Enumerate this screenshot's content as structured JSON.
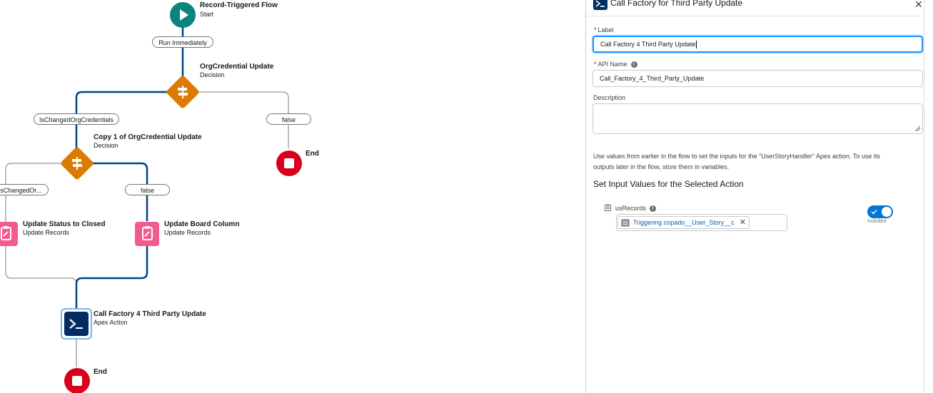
{
  "flow": {
    "start": {
      "title": "Record-Triggered Flow",
      "subtitle": "Start"
    },
    "run_pill": "Run Immediately",
    "decision1": {
      "title": "OrgCredential Update",
      "subtitle": "Decision"
    },
    "outcome_true1": "IsChangedOrgCredentials",
    "outcome_false1": "false",
    "end1": "End",
    "decision2": {
      "title": "Copy 1 of OrgCredential Update",
      "subtitle": "Decision"
    },
    "outcome_true2": "IsChangedOr...",
    "outcome_false2": "false",
    "update1": {
      "title": "Update Status to Closed",
      "subtitle": "Update Records"
    },
    "update2": {
      "title": "Update Board Column",
      "subtitle": "Update Records"
    },
    "apex": {
      "title": "Call Factory 4 Third Party Update",
      "subtitle": "Apex Action"
    },
    "end2": "End"
  },
  "panel": {
    "title": "Call Factory for Third Party Update",
    "close": "✕",
    "label_field": {
      "label": "Label",
      "value": "Call Factory 4 Third Party Update"
    },
    "api_field": {
      "label": "API Name",
      "value": "Call_Factory_4_Third_Party_Update"
    },
    "description_field": {
      "label": "Description",
      "value": ""
    },
    "help_line1": "Use values from earlier in the flow to set the inputs for the \"UserStoryHandler\" Apex action. To use its",
    "help_line2": "outputs later in the flow, store them in variables.",
    "section_title": "Set Input Values for the Selected Action",
    "input": {
      "name": "usRecords",
      "token": "Triggering copado__User_Story__c",
      "toggle_label": "Included",
      "toggle_on": true
    }
  },
  "colors": {
    "connector_active": "#014486",
    "connector_inactive": "#a5a5a5",
    "start": "#0b827c",
    "decision": "#dd7a01",
    "end": "#d8001b",
    "update": "#f35a8e",
    "apex": "#032d60",
    "focus": "#1b96ff"
  }
}
